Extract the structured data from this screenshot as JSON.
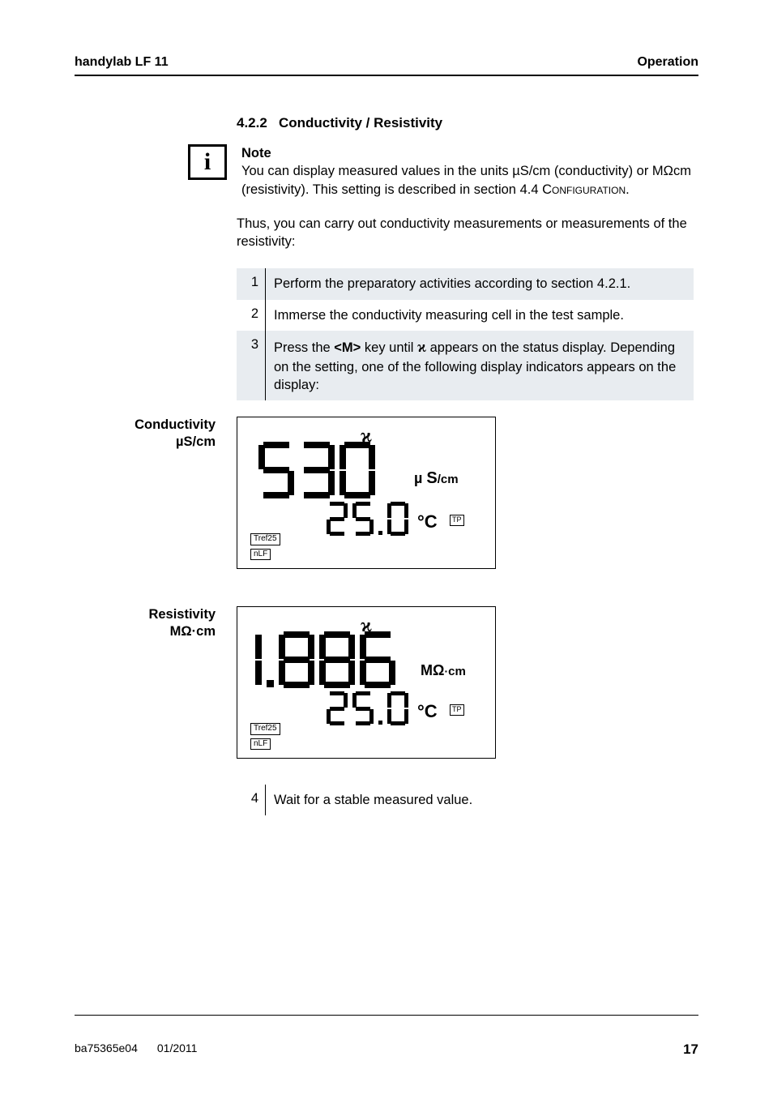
{
  "header": {
    "left": "handylab LF 11",
    "right": "Operation"
  },
  "section": {
    "number": "4.2.2",
    "title": "Conductivity / Resistivity"
  },
  "note": {
    "label": "Note",
    "body_pre": "You can display measured values in the units ",
    "unit1": "µS/cm",
    "body_mid": " (conductivity) or ",
    "unit2": "MΩcm",
    "body_post": " (resistivity). This setting is described in section 4.4 ",
    "sc_word": "Configuration",
    "body_end": "."
  },
  "intro": "Thus, you can carry out conductivity measurements or measurements of the resistivity:",
  "steps": [
    {
      "n": "1",
      "text": "Perform the preparatory activities according to section 4.2.1."
    },
    {
      "n": "2",
      "text": "Immerse the conductivity measuring cell in the test sample."
    },
    {
      "n": "3",
      "pre": "Press the ",
      "key": "<M>",
      "mid": " key until ",
      "sym": "ϰ",
      "post": " appears on the status display. Depending on the setting, one of the following display indicators appears on the display:"
    }
  ],
  "displays": {
    "cond": {
      "label_l1": "Conductivity",
      "label_l2": "µS/cm",
      "main_value": "530",
      "main_unit_pre": "µ",
      "main_unit": "S/cm",
      "sub_value": "25.0",
      "sub_unit": "°C",
      "tp": "TP",
      "tag1": "Tref25",
      "tag2": "nLF",
      "chi": "ϰ"
    },
    "res": {
      "label_l1": "Resistivity",
      "label_l2": "MΩ·cm",
      "main_value": "1.886",
      "main_unit": "MΩ·cm",
      "sub_value": "25.0",
      "sub_unit": "°C",
      "tp": "TP",
      "tag1": "Tref25",
      "tag2": "nLF",
      "chi": "ϰ"
    }
  },
  "step4": {
    "n": "4",
    "text": "Wait for a stable measured value."
  },
  "footer": {
    "doc": "ba75365e04",
    "date": "01/2011",
    "page": "17"
  }
}
